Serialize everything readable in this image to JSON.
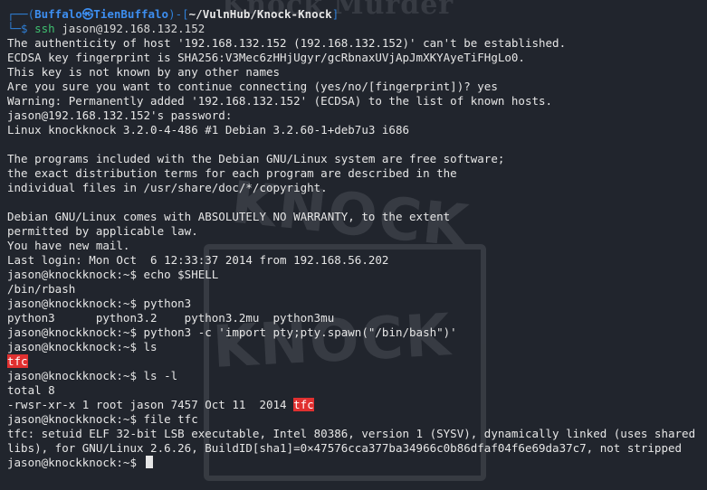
{
  "prompt_line": {
    "corner_top": "┌──(",
    "user_host": "Buffalo㉿TienBuffalo",
    "close_open": ")-[",
    "path": "~/VulnHub/Knock-Knock",
    "close": "]",
    "corner_bottom": "└─$ ",
    "command": "ssh",
    "args": " jason@192.168.132.152"
  },
  "output_lines": [
    "The authenticity of host '192.168.132.152 (192.168.132.152)' can't be established.",
    "ECDSA key fingerprint is SHA256:V3Mec6zHHjUgyr/gcRbnaxUVjApJmXKYAyeTiFHgLo0.",
    "This key is not known by any other names",
    "Are you sure you want to continue connecting (yes/no/[fingerprint])? yes",
    "Warning: Permanently added '192.168.132.152' (ECDSA) to the list of known hosts.",
    "jason@192.168.132.152's password:",
    "Linux knockknock 3.2.0-4-486 #1 Debian 3.2.60-1+deb7u3 i686"
  ],
  "motd_lines": [
    "The programs included with the Debian GNU/Linux system are free software;",
    "the exact distribution terms for each program are described in the",
    "individual files in /usr/share/doc/*/copyright."
  ],
  "warranty_lines": [
    "Debian GNU/Linux comes with ABSOLUTELY NO WARRANTY, to the extent",
    "permitted by applicable law.",
    "You have new mail.",
    "Last login: Mon Oct  6 12:33:37 2014 from 192.168.56.202"
  ],
  "remote_prompt": "jason@knockknock:~$ ",
  "session": {
    "cmd_echo": "echo $SHELL",
    "out_echo": "/bin/rbash",
    "cmd_python3": "python3",
    "out_python3": "python3      python3.2    python3.2mu  python3mu",
    "cmd_pty": "python3 -c 'import pty;pty.spawn(\"/bin/bash\")'",
    "cmd_ls": "ls",
    "out_ls_file": "tfc",
    "cmd_lsl": "ls -l",
    "out_total": "total 8",
    "out_lsl_prefix": "-rwsr-xr-x 1 root jason 7457 Oct 11  2014 ",
    "out_lsl_file": "tfc",
    "cmd_file": "file tfc",
    "out_file": "tfc: setuid ELF 32-bit LSB executable, Intel 80386, version 1 (SYSV), dynamically linked (uses shared libs), for GNU/Linux 2.6.26, BuildID[sha1]=0×47576cca377ba34966c0b86dfaf04f6e69da37c7, not stripped"
  },
  "colors": {
    "background": "#21252d",
    "text": "#e6e6e6",
    "prompt_blue": "#3d8ef0",
    "command_green": "#3fc070",
    "highlight_red": "#e03030"
  }
}
